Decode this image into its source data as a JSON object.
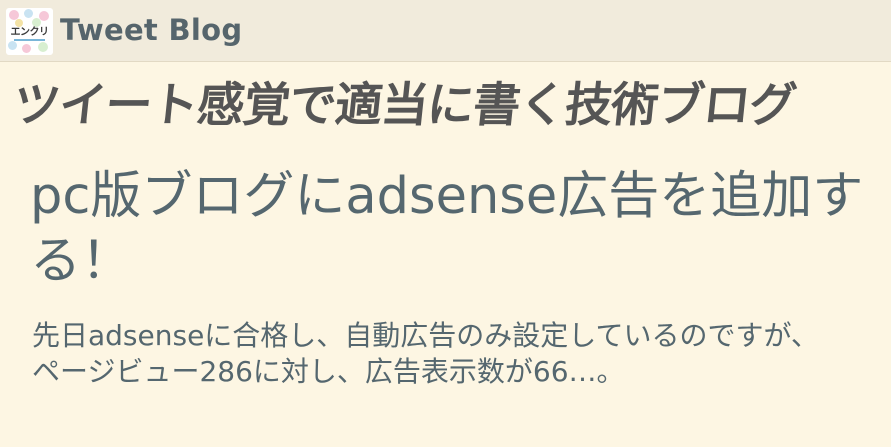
{
  "header": {
    "logo_text": "エンクリ",
    "site_name": "Tweet Blog"
  },
  "tagline": "ツイート感覚で適当に書く技術ブログ",
  "post": {
    "title": "pc版ブログにadsense広告を追加する！",
    "excerpt": "先日adsenseに合格し、自動広告のみ設定しているのですが、ページビュー286に対し、広告表示数が66…。"
  },
  "colors": {
    "page_background": "#fdf6e3",
    "header_background": "#f1ebdc",
    "text_primary": "#55676f",
    "tagline_text": "#555555"
  }
}
